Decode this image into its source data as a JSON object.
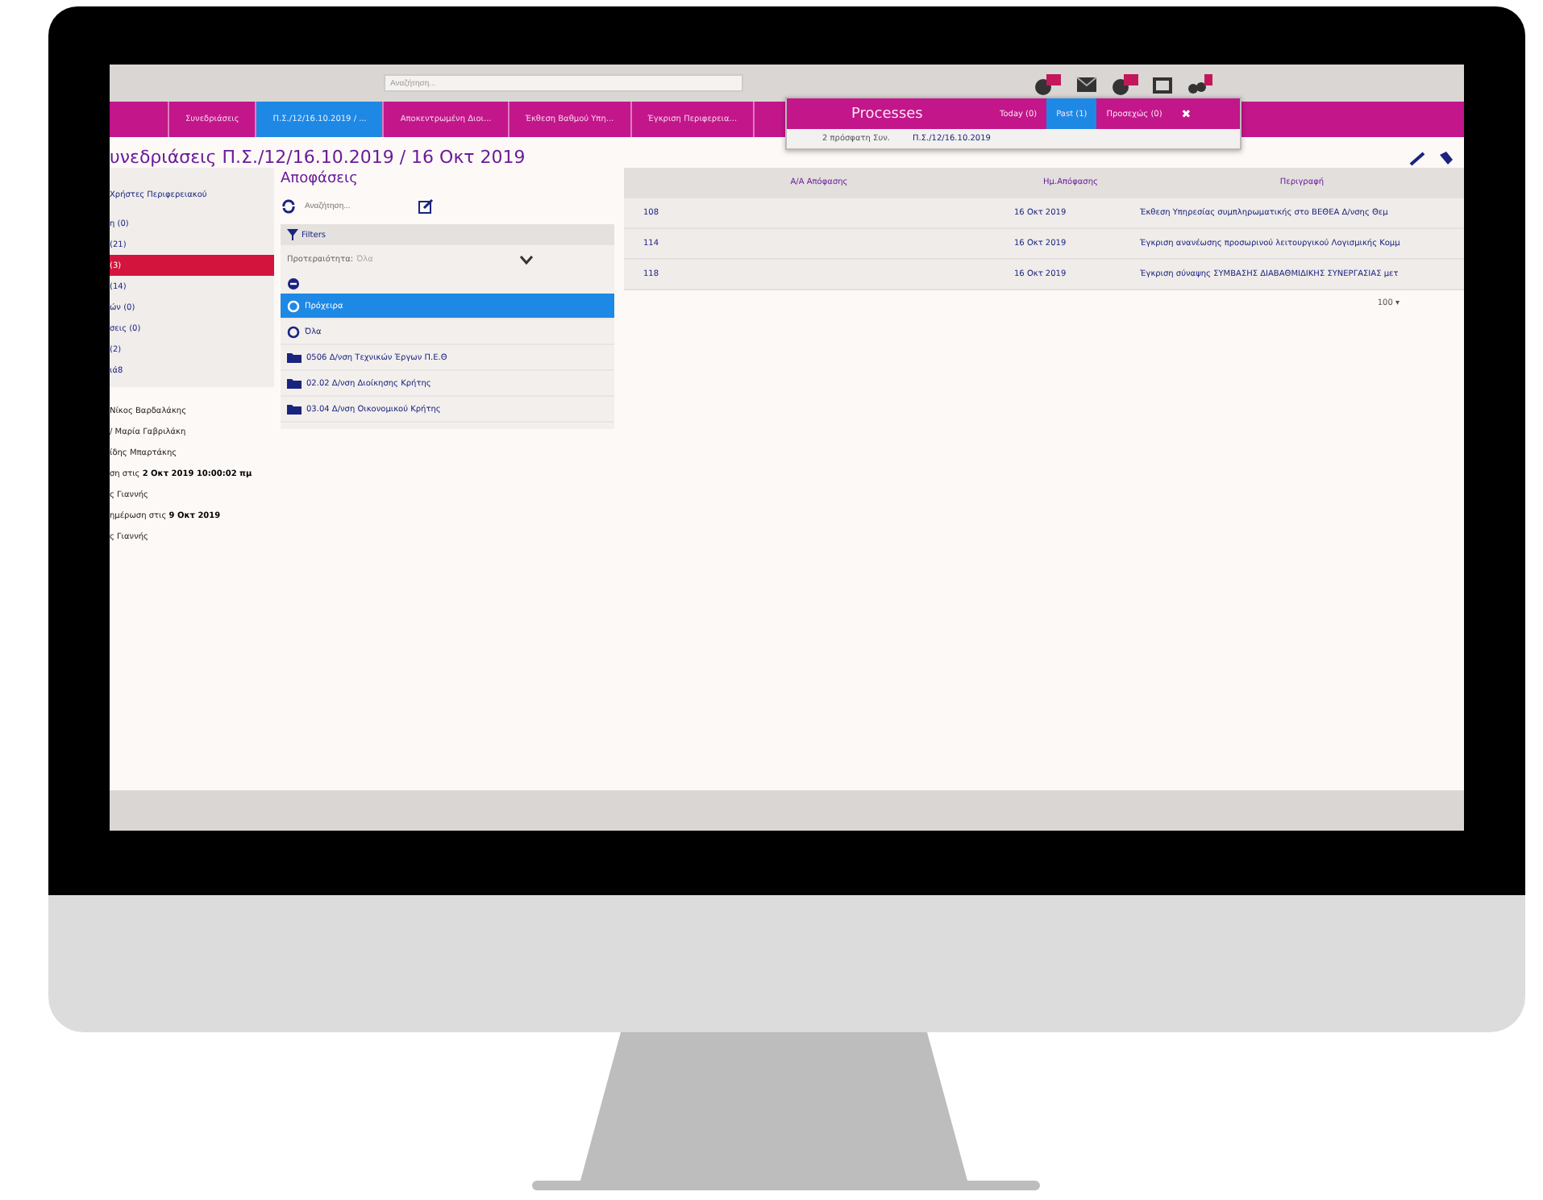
{
  "top_bar": {
    "search": {
      "placeholder": "Αναζήτηση..."
    }
  },
  "nav_tabs": [
    {
      "label": "Συνεδριάσεις",
      "selected": false
    },
    {
      "label": "Π.Σ./12/16.10.2019 / ...",
      "selected": true
    },
    {
      "label": "Αποκεντρωμένη Διοι...",
      "selected": false
    },
    {
      "label": "Έκθεση Βαθμού Υπη...",
      "selected": false
    },
    {
      "label": "Έγκριση Περιφερεια...",
      "selected": false
    }
  ],
  "processes_popup": {
    "title": "Processes",
    "tabs": [
      {
        "label": "Today (0)",
        "selected": false
      },
      {
        "label": "Past (1)",
        "selected": true
      },
      {
        "label": "Προσεχώς (0)",
        "selected": false
      }
    ],
    "close": "✖",
    "rows": [
      {
        "label": "2 πρόσφατη Συν.",
        "value": "Π.Σ./12/16.10.2019"
      }
    ]
  },
  "page_title": "υνεδριάσεις Π.Σ./12/16.10.2019 / 16 Οκτ 2019",
  "sidebar": {
    "header": "Χρήστες Περιφερειακού",
    "items": [
      {
        "label": "η (0)",
        "selected": false
      },
      {
        "label": "(21)",
        "selected": false
      },
      {
        "label": "(3)",
        "selected": true
      },
      {
        "label": "(14)",
        "selected": false
      },
      {
        "label": "ών (0)",
        "selected": false
      },
      {
        "label": "σεις (0)",
        "selected": false
      },
      {
        "label": "(2)",
        "selected": false
      },
      {
        "label": "ιά8",
        "selected": false
      }
    ],
    "details": [
      "Νίκος Βαρδαλάκης",
      "/ Μαρία Γαβριλάκη",
      "ίδης Μπαρτάκης",
      "ση στις **2 Οκτ 2019 10:00:02 πμ**",
      "ς Γιαννής",
      "ημέρωση στις **9 Οκτ 2019**",
      "ς Γιαννής"
    ]
  },
  "decisions": {
    "title": "Αποφάσεις",
    "search": {
      "placeholder": "Αναζήτηση..."
    },
    "filters": {
      "title": "Filters",
      "priority": {
        "label": "Προτεραιότητα:",
        "value": "Όλα"
      },
      "items": [
        {
          "kind": "status",
          "label": "Πρόχειρα",
          "selected": true
        },
        {
          "kind": "status",
          "label": "Όλα",
          "selected": false
        },
        {
          "kind": "folder",
          "label": "0506 Δ/νση Τεχνικών Έργων Π.Ε.Θ",
          "selected": false
        },
        {
          "kind": "folder",
          "label": "02.02 Δ/νση Διοίκησης Κρήτης",
          "selected": false
        },
        {
          "kind": "folder",
          "label": "03.04 Δ/νση Οικονομικού Κρήτης",
          "selected": false
        }
      ]
    }
  },
  "table": {
    "columns": [
      "Α/Α Απόφασης",
      "Ημ.Απόφασης",
      "Περιγραφή"
    ],
    "rows": [
      [
        "108",
        "16 Οκτ 2019",
        "Έκθεση Υπηρεσίας συμπληρωματικής στο ΒΕΘΕΑ Δ/νσης Θεμ"
      ],
      [
        "114",
        "16 Οκτ 2019",
        "Έγκριση ανανέωσης προσωρινού λειτουργικού Λογισμικής Κομμ"
      ],
      [
        "118",
        "16 Οκτ 2019",
        "Έγκριση σύναψης ΣΥΜΒΑΣΗΣ ΔΙΑΒΑΘΜΙΔΙΚΗΣ ΣΥΝΕΡΓΑΣΙΑΣ μετ"
      ]
    ],
    "page_size": "100 ▾"
  }
}
